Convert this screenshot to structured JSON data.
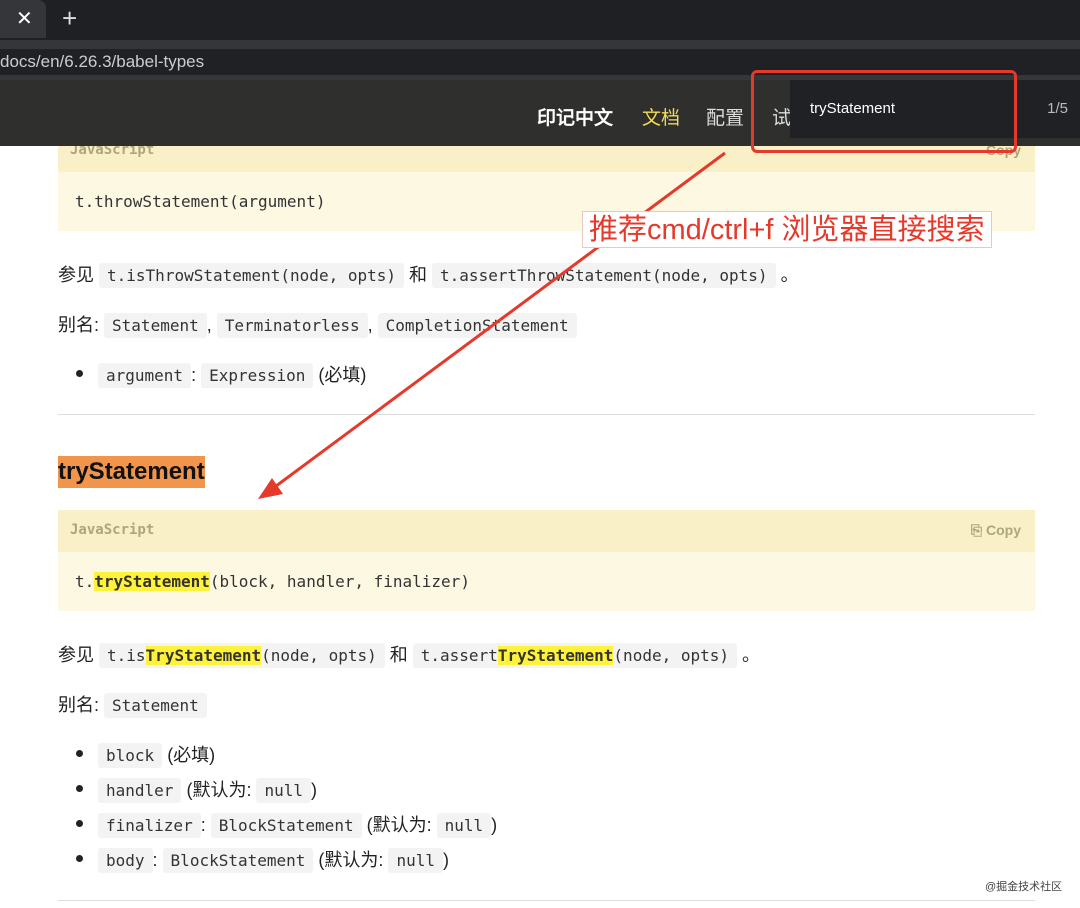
{
  "browser": {
    "close_tab": "✕",
    "new_tab": "+",
    "url": "docs/en/6.26.3/babel-types"
  },
  "header": {
    "brand": "印记中文",
    "docs": "文档",
    "config": "配置",
    "try": "试"
  },
  "find": {
    "query": "tryStatement",
    "count": "1/5"
  },
  "annotation": "推荐cmd/ctrl+f 浏览器直接搜索",
  "throw": {
    "lang": "JavaScript",
    "copy": "Copy",
    "code": "t.throwStatement(argument)",
    "see": "参见",
    "is": "t.isThrowStatement(node, opts)",
    "and": "和",
    "assert": "t.assertThrowStatement(node, opts)",
    "period": "。",
    "alias_label": "别名:",
    "aliases": [
      "Statement",
      "Terminatorless",
      "CompletionStatement"
    ],
    "params": [
      {
        "name": "argument",
        "type": "Expression",
        "note": "(必填)"
      }
    ]
  },
  "try": {
    "title": "tryStatement",
    "lang": "JavaScript",
    "copy": "Copy",
    "code_pre": "t.",
    "code_hl": "tryStatement",
    "code_post": "(block, handler, finalizer)",
    "see": "参见",
    "is_pre": "t.is",
    "is_hl": "TryStatement",
    "is_post": "(node, opts)",
    "and": "和",
    "assert_pre": "t.assert",
    "assert_hl": "TryStatement",
    "assert_post": "(node, opts)",
    "period": "。",
    "alias_label": "别名:",
    "alias": "Statement",
    "params": [
      {
        "name": "block",
        "note": "(必填)"
      },
      {
        "name": "handler",
        "note": "(默认为:",
        "default": "null",
        "close": ")"
      },
      {
        "name": "finalizer",
        "type": "BlockStatement",
        "note": "(默认为:",
        "default": "null",
        "close": ")"
      },
      {
        "name": "body",
        "type": "BlockStatement",
        "note": "(默认为:",
        "default": "null",
        "close": ")"
      }
    ]
  },
  "watermark": "@掘金技术社区"
}
